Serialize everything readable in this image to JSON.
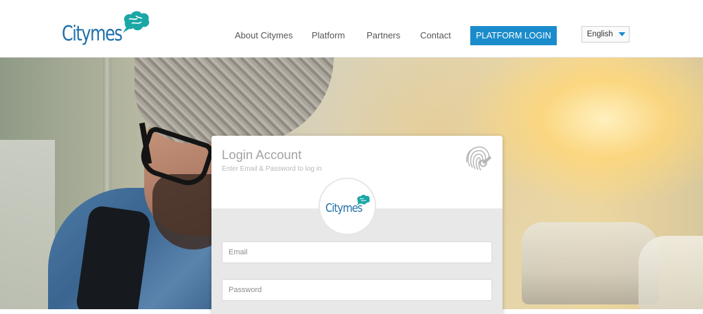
{
  "header": {
    "logo_text": "Citymes",
    "nav": [
      {
        "label": "About Citymes"
      },
      {
        "label": "Platform"
      },
      {
        "label": "Partners"
      },
      {
        "label": "Contact"
      }
    ],
    "login_button": "PLATFORM LOGIN",
    "language": "English"
  },
  "login_card": {
    "title": "Login Account",
    "subtitle": "Enter Email & Password to log in",
    "badge_logo_text": "Citymes",
    "email_placeholder": "Email",
    "password_placeholder": "Password"
  },
  "colors": {
    "brand_blue": "#1e6fa8",
    "accent_teal": "#1aa7a6",
    "button_blue": "#1b8ccb"
  },
  "icons": {
    "logo": "brain-icon",
    "fingerprint": "fingerprint-icon",
    "language_caret": "caret-down-icon"
  }
}
